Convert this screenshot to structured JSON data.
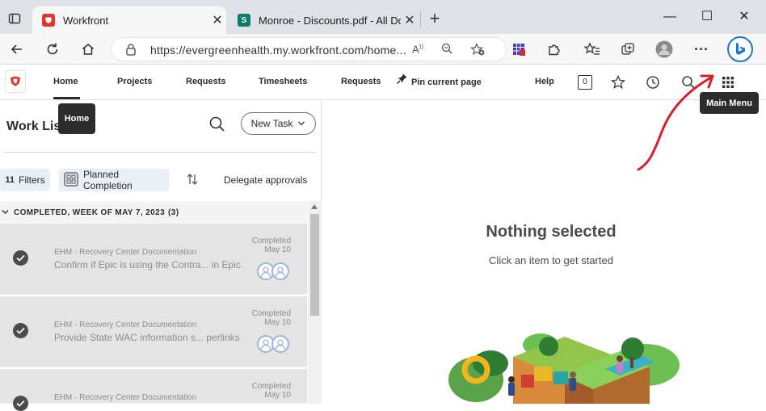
{
  "browser": {
    "tabs": [
      {
        "title": "Workfront",
        "favicon": "workfront-icon",
        "active": true
      },
      {
        "title": "Monroe - Discounts.pdf - All Doc",
        "favicon": "sharepoint-icon",
        "active": false
      }
    ],
    "new_tab_label": "+",
    "url": "https://evergreenhealth.my.workfront.com/home...",
    "window_controls": {
      "minimize": "—",
      "maximize": "☐",
      "close": "✕"
    }
  },
  "wf_nav": {
    "items": [
      "Home",
      "Projects",
      "Requests",
      "Timesheets",
      "Requests"
    ],
    "pin_label": "Pin current page",
    "help_label": "Help",
    "notification_count": "0",
    "home_tooltip": "Home",
    "main_menu_tooltip": "Main Menu"
  },
  "worklist": {
    "title": "Work Lis",
    "new_task_label": "New Task",
    "filters_count": "11",
    "filters_label": "Filters",
    "sort_label": "Planned Completion",
    "delegate_label": "Delegate approvals",
    "group_header": "COMPLETED, WEEK OF MAY 7, 2023",
    "group_count": "(3)",
    "tasks": [
      {
        "project": "EHM - Recovery Center Documentation",
        "name": "Confirm if Epic is using the Contra... in Epic.",
        "status": "Completed",
        "date": "May 10"
      },
      {
        "project": "EHM - Recovery Center Documentation",
        "name": "Provide State WAC information s... perlinks",
        "status": "Completed",
        "date": "May 10"
      },
      {
        "project": "EHM - Recovery Center Documentation",
        "name": "",
        "status": "Completed",
        "date": "May 10"
      }
    ]
  },
  "detail": {
    "empty_title": "Nothing selected",
    "empty_subtitle": "Click an item to get started"
  },
  "colors": {
    "workfront_red": "#e3372c",
    "annotation_red": "#d61f2b",
    "tooltip_bg": "#2c2c2c"
  }
}
